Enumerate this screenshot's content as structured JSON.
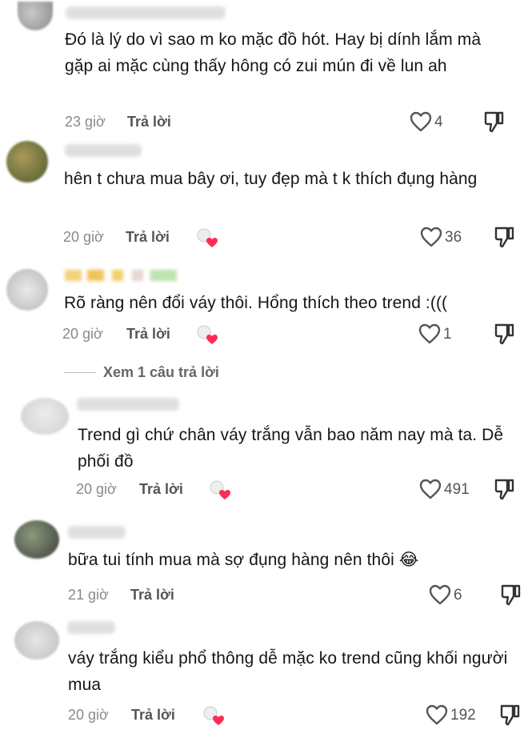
{
  "comments": [
    {
      "text": "Đó là lý do vì sao m ko mặc đồ hót. Hay bị dính lắm mà gặp ai mặc cùng thấy hông có zui mún đi về lun ah",
      "time": "23 giờ",
      "reply_label": "Trả lời",
      "likes": "4",
      "creator_liked": false
    },
    {
      "text": "hên t chưa mua bây ơi, tuy đẹp mà t k thích đụng hàng",
      "time": "20 giờ",
      "reply_label": "Trả lời",
      "likes": "36",
      "creator_liked": true
    },
    {
      "text": "Rõ ràng nên đổi váy thôi. Hổng thích theo trend :(((",
      "time": "20 giờ",
      "reply_label": "Trả lời",
      "likes": "1",
      "creator_liked": true
    },
    {
      "text": "Trend gì chứ chân váy trắng vẫn bao năm nay mà ta. Dễ phối đồ",
      "time": "20 giờ",
      "reply_label": "Trả lời",
      "likes": "491",
      "creator_liked": true
    },
    {
      "text": "bữa tui tính mua mà sợ đụng hàng nên thôi 😂",
      "time": "21 giờ",
      "reply_label": "Trả lời",
      "likes": "6",
      "creator_liked": false
    },
    {
      "text": "váy trắng kiểu phổ thông dễ mặc ko trend cũng khối người mua",
      "time": "20 giờ",
      "reply_label": "Trả lời",
      "likes": "192",
      "creator_liked": true
    }
  ],
  "view_replies_label": "Xem 1 câu trả lời",
  "colors": {
    "creator_heart": "#fe2c55",
    "secondary_text": "#8a8a8a"
  },
  "icons": {
    "like": "heart-outline-icon",
    "dislike": "thumbs-down-icon",
    "creator_like": "creator-heart-icon"
  }
}
